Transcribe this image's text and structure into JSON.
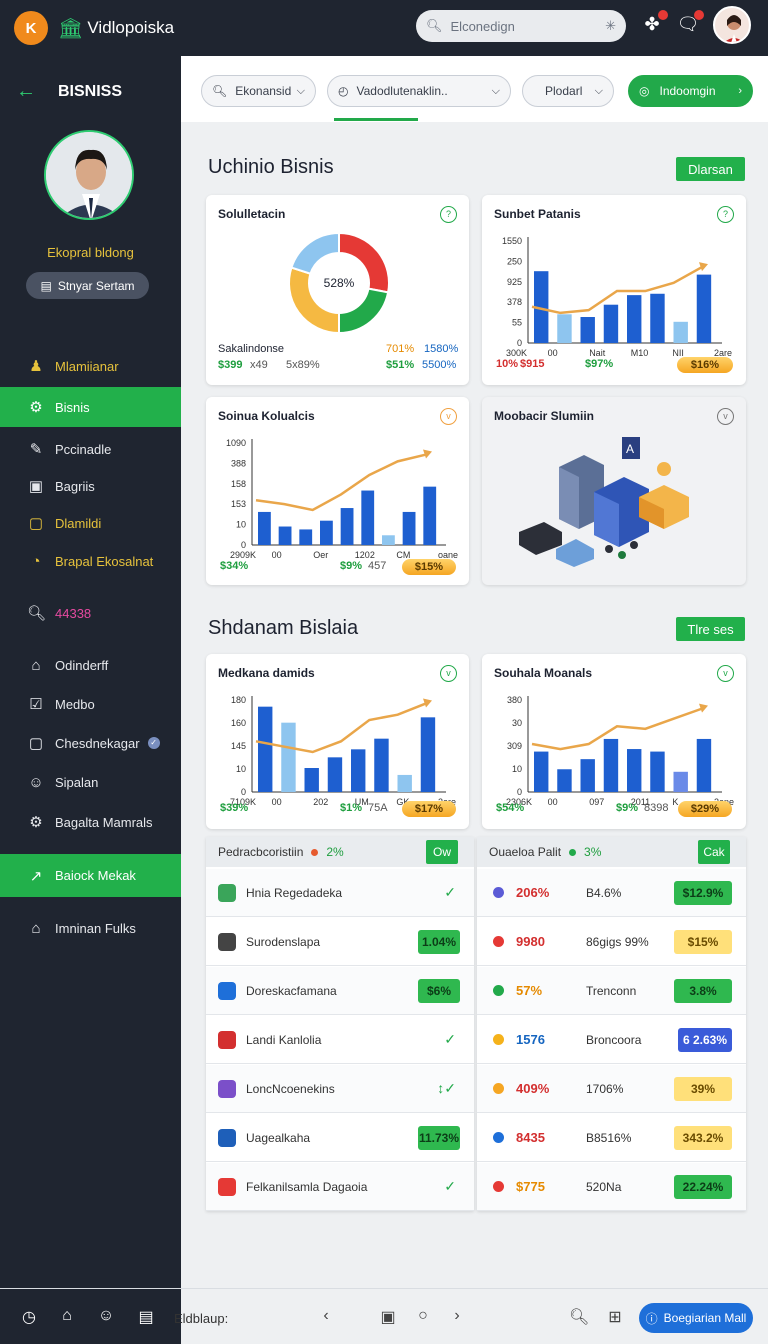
{
  "app": {
    "logo_letter": "K",
    "brand": "Vidlopoiska"
  },
  "search": {
    "placeholder": "Elconedign"
  },
  "sidebar": {
    "header": "BISNISS",
    "profile_name": "Ekopral bldong",
    "profile_button": "Stnyar Sertam",
    "items": [
      {
        "label": "Mlamiianar",
        "icon": "user-icon",
        "style": "yellow"
      },
      {
        "label": "Bisnis",
        "icon": "briefcase-icon",
        "style": "active"
      },
      {
        "label": "Pccinadle",
        "icon": "edit-icon",
        "style": ""
      },
      {
        "label": "Bagriis",
        "icon": "square-icon",
        "style": ""
      },
      {
        "label": "Dlamildi",
        "icon": "checkbox-icon",
        "style": "yellow"
      },
      {
        "label": "Brapal Ekosalnat",
        "icon": "compass-icon",
        "style": "yellow"
      },
      {
        "label": "44338",
        "icon": "search-icon",
        "style": "pink"
      },
      {
        "label": "Odinderff",
        "icon": "home-icon",
        "style": ""
      },
      {
        "label": "Medbo",
        "icon": "check-square-icon",
        "style": ""
      },
      {
        "label": "Chesdnekagar",
        "icon": "square-icon",
        "style": ""
      },
      {
        "label": "Sipalan",
        "icon": "person-icon",
        "style": ""
      },
      {
        "label": "Bagalta Mamrals",
        "icon": "gear-icon",
        "style": ""
      },
      {
        "label": "Baiock Mekak",
        "icon": "chart-icon",
        "style": "active"
      },
      {
        "label": "Imninan Fulks",
        "icon": "home-icon",
        "style": ""
      }
    ]
  },
  "filters": {
    "chip1": "Ekonansid",
    "chip2": "Vadodlutenaklin..",
    "chip3": "Plodarl",
    "chip4": "Indoomgin"
  },
  "section1": {
    "title": "Uchinio Bisnis",
    "button": "Dlarsan",
    "card1": {
      "title": "Solulletacin",
      "center_label": "528%",
      "foot_label": "Sakalindonse",
      "v1": "$399",
      "v2": "x49",
      "v3": "5x89%",
      "v4": "701%",
      "v5": "1580%",
      "v6": "$51%",
      "v7": "5500%"
    },
    "card2": {
      "title": "Sunbet Patanis",
      "yticks": [
        "1550",
        "250",
        "925",
        "378",
        "55",
        "0"
      ],
      "xticks": [
        "300K",
        "00",
        "Nait",
        "M10",
        "NII",
        "2are"
      ],
      "f1": "10%",
      "f2": "$915",
      "f3": "$97%",
      "pill": "$16%"
    },
    "card3": {
      "title": "Soinua Kolualcis",
      "yticks": [
        "1090",
        "388",
        "158",
        "153",
        "10",
        "0"
      ],
      "xticks": [
        "2909K",
        "00",
        "Oer",
        "1202",
        "CM",
        "oane"
      ],
      "f1": "$34%",
      "f2": "$9%",
      "f3": "457",
      "pill": "$15%"
    },
    "card4": {
      "title": "Moobacir Slumiin"
    }
  },
  "section2": {
    "title": "Shdanam Bislaia",
    "button": "Tlre ses",
    "card1": {
      "title": "Medkana damids",
      "yticks": [
        "180",
        "160",
        "145",
        "10",
        "0"
      ],
      "xticks": [
        "7109K",
        "00",
        "202",
        "UM",
        "GK",
        "2are"
      ],
      "f1": "$39%",
      "f2": "$1%",
      "f3": "75A",
      "pill": "$17%"
    },
    "card2": {
      "title": "Souhala Moanals",
      "yticks": [
        "380",
        "30",
        "309",
        "10",
        "0"
      ],
      "xticks": [
        "2306K",
        "00",
        "097",
        "2011",
        "K",
        "2ene"
      ],
      "f1": "$54%",
      "f2": "$9%",
      "f3": "8398",
      "pill": "$29%"
    }
  },
  "table_left": {
    "header": "Pedracbcoristiin",
    "header_pct": "2%",
    "button": "Ow",
    "rows": [
      {
        "name": "Hnia Regedadeka",
        "icon_color": "#3aa55a",
        "value": "",
        "kind": "check"
      },
      {
        "name": "Surodenslapa",
        "icon_color": "#444444",
        "value": "1.04%",
        "kind": "g"
      },
      {
        "name": "Doreskacfamana",
        "icon_color": "#1e6fd9",
        "value": "$6%",
        "kind": "g"
      },
      {
        "name": "Landi Kanlolia",
        "icon_color": "#d32f2f",
        "value": "",
        "kind": "check"
      },
      {
        "name": "LoncNcoenekins",
        "icon_color": "#7b4fc9",
        "value": "",
        "kind": "check2"
      },
      {
        "name": "Uagealkaha",
        "icon_color": "#1e5fb9",
        "value": "11.73%",
        "kind": "g"
      },
      {
        "name": "Felkanilsamla Dagaoia",
        "icon_color": "#e53935",
        "value": "",
        "kind": "check"
      }
    ]
  },
  "table_right": {
    "header": "Ouaeloa Palit",
    "header_pct": "3%",
    "button": "Cak",
    "rows": [
      {
        "pct": "206%",
        "dot": "#5b5bd6",
        "pct_color": "#d32f2f",
        "name": "B4.6%",
        "value": "$12.9%",
        "kind": "g"
      },
      {
        "pct": "9980",
        "dot": "#e53935",
        "pct_color": "#d32f2f",
        "name": "86gigs 99%",
        "value": "$15%",
        "kind": "y"
      },
      {
        "pct": "57%",
        "dot": "#22a94a",
        "pct_color": "#e58a00",
        "name": "Trenconn",
        "value": "3.8%",
        "kind": "g"
      },
      {
        "pct": "1576",
        "dot": "#f5b21b",
        "pct_color": "#1565c0",
        "name": "Broncoora",
        "value": "6 2.63%",
        "kind": "b"
      },
      {
        "pct": "409%",
        "dot": "#f5a623",
        "pct_color": "#d32f2f",
        "name": "1706%",
        "value": "39%",
        "kind": "y"
      },
      {
        "pct": "8435",
        "dot": "#1e6fd9",
        "pct_color": "#d32f2f",
        "name": "B8516%",
        "value": "343.2%",
        "kind": "y"
      },
      {
        "pct": "$775",
        "dot": "#e53935",
        "pct_color": "#e58a00",
        "name": "520Na",
        "value": "22.24%",
        "kind": "g"
      }
    ]
  },
  "bottom": {
    "label": "Eldblaup:",
    "button": "Boegiarian Mall"
  },
  "chart_data": [
    {
      "type": "pie",
      "title": "Solulletacin",
      "values": [
        28,
        22,
        30,
        20
      ],
      "colors": [
        "#e53935",
        "#22a94a",
        "#f5b942",
        "#8ec5ef"
      ]
    },
    {
      "type": "bar",
      "title": "Sunbet Patanis",
      "values": [
        1050,
        420,
        380,
        560,
        700,
        720,
        310,
        1000
      ],
      "colors": [
        "#1e5fd0",
        "#8ec5ef",
        "#1e5fd0",
        "#1e5fd0",
        "#1e5fd0",
        "#1e5fd0",
        "#8ec5ef",
        "#1e5fd0"
      ],
      "line": [
        530,
        440,
        480,
        760,
        760,
        880,
        1110
      ],
      "ylim": [
        0,
        1550
      ]
    },
    {
      "type": "bar",
      "title": "Soinua Kolualcis",
      "values": [
        340,
        190,
        160,
        250,
        380,
        560,
        100,
        340,
        600
      ],
      "colors": [
        "#1e5fd0",
        "#1e5fd0",
        "#1e5fd0",
        "#1e5fd0",
        "#1e5fd0",
        "#1e5fd0",
        "#8ec5ef",
        "#1e5fd0",
        "#1e5fd0"
      ],
      "line": [
        460,
        420,
        360,
        520,
        720,
        860,
        930
      ],
      "ylim": [
        0,
        1090
      ]
    },
    {
      "type": "bar",
      "title": "Medkana damids",
      "values": [
        160,
        130,
        45,
        65,
        80,
        100,
        32,
        140
      ],
      "colors": [
        "#1e5fd0",
        "#8ec5ef",
        "#1e5fd0",
        "#1e5fd0",
        "#1e5fd0",
        "#1e5fd0",
        "#8ec5ef",
        "#1e5fd0"
      ],
      "line": [
        95,
        85,
        75,
        95,
        135,
        145,
        166
      ],
      "ylim": [
        0,
        180
      ]
    },
    {
      "type": "bar",
      "title": "Souhala Moanals",
      "values": [
        160,
        90,
        130,
        210,
        170,
        160,
        80,
        210
      ],
      "colors": [
        "#1e5fd0",
        "#1e5fd0",
        "#1e5fd0",
        "#1e5fd0",
        "#1e5fd0",
        "#1e5fd0",
        "#6a8ae8",
        "#1e5fd0"
      ],
      "line": [
        190,
        170,
        190,
        260,
        250,
        290,
        330
      ],
      "ylim": [
        0,
        380
      ]
    }
  ]
}
